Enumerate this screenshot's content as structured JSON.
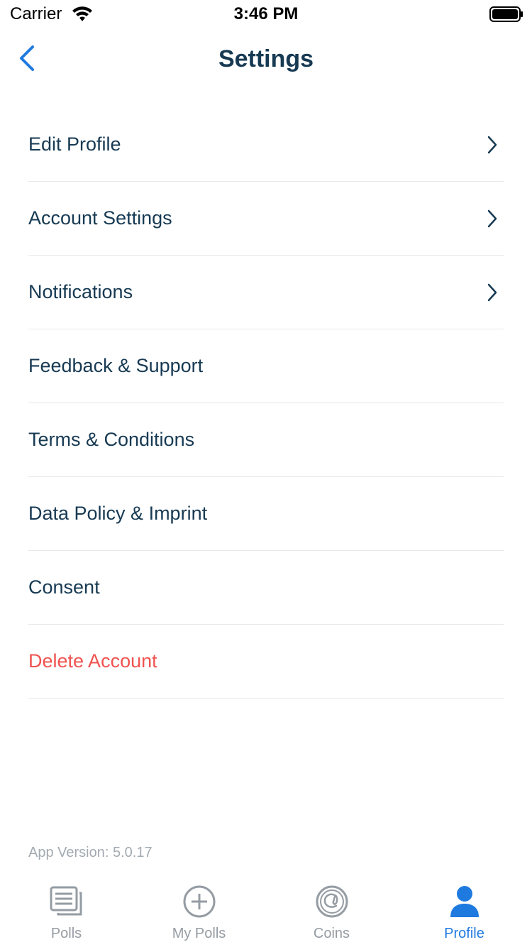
{
  "status_bar": {
    "carrier": "Carrier",
    "time": "3:46 PM"
  },
  "nav": {
    "title": "Settings",
    "back_icon": "chevron-left-icon"
  },
  "settings": {
    "items": [
      {
        "label": "Edit Profile",
        "has_chevron": true
      },
      {
        "label": "Account Settings",
        "has_chevron": true
      },
      {
        "label": "Notifications",
        "has_chevron": true
      },
      {
        "label": "Feedback & Support",
        "has_chevron": false
      },
      {
        "label": "Terms & Conditions",
        "has_chevron": false
      },
      {
        "label": "Data Policy & Imprint",
        "has_chevron": false
      },
      {
        "label": "Consent",
        "has_chevron": false
      },
      {
        "label": "Delete Account",
        "has_chevron": false,
        "danger": true
      }
    ]
  },
  "footer": {
    "app_version": "App Version: 5.0.17"
  },
  "tab_bar": {
    "tabs": [
      {
        "label": "Polls",
        "icon": "polls-icon"
      },
      {
        "label": "My Polls",
        "icon": "plus-circle-icon"
      },
      {
        "label": "Coins",
        "icon": "coins-icon"
      },
      {
        "label": "Profile",
        "icon": "profile-icon",
        "active": true
      }
    ]
  },
  "colors": {
    "primary_text": "#173a53",
    "accent": "#1f7ae0",
    "danger": "#ef5350",
    "muted": "#959ca3",
    "divider": "#e6e8ea"
  }
}
